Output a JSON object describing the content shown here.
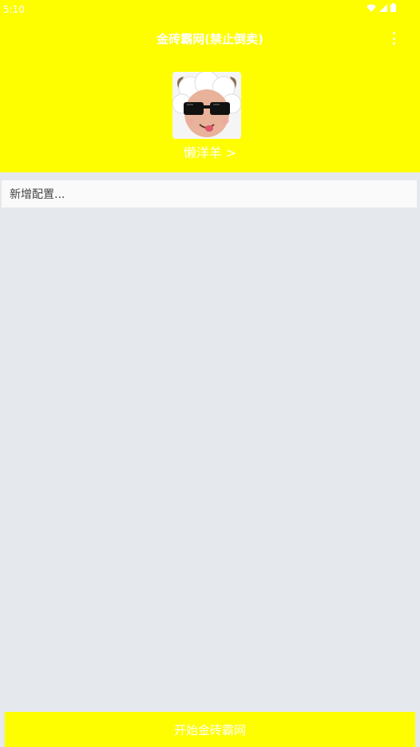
{
  "status_bar": {
    "time": "5:10",
    "icons": [
      "wifi-icon",
      "signal-icon",
      "battery-icon"
    ]
  },
  "toolbar": {
    "title": "金砖霸网(禁止倒卖)",
    "menu_icon": "more-vert-icon"
  },
  "profile": {
    "avatar": "lazy-sheep-sunglasses-avatar",
    "name": "懒洋羊 >"
  },
  "config": {
    "add_label": "新增配置..."
  },
  "footer": {
    "start_label": "开始金砖霸网"
  },
  "colors": {
    "accent": "#fefe00",
    "background": "#e5e8ed",
    "row": "#fafafb",
    "text_on_accent": "#ffffff"
  }
}
